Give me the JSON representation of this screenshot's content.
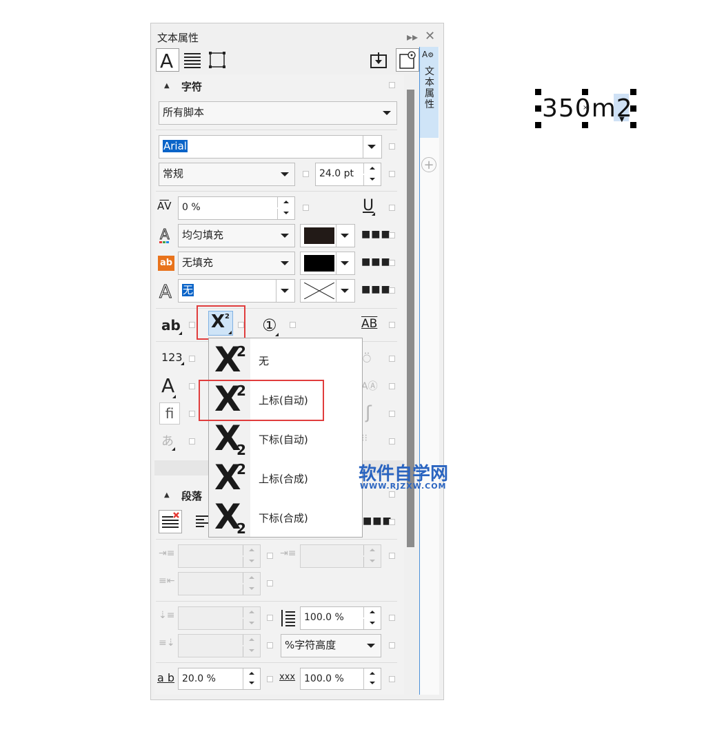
{
  "panel": {
    "title": "文本属性",
    "header_icons": [
      "expand-icon",
      "close-icon"
    ],
    "toolbar": {
      "tabs": [
        "character-tab",
        "paragraph-tab",
        "frame-tab"
      ],
      "right": [
        "import-icon",
        "preview-icon"
      ]
    }
  },
  "sidebar": {
    "tab_label": "文本属性"
  },
  "character": {
    "section_title": "字符",
    "script_select": "所有脚本",
    "font_name": "Arial",
    "font_style": "常规",
    "font_size": "24.0 pt",
    "kerning": "0 %",
    "fill_type": "均匀填充",
    "fill_color": "#221a17",
    "bg_fill_type": "无填充",
    "bg_fill_color": "#000000",
    "outline": "无"
  },
  "menu": {
    "items": [
      {
        "label": "无",
        "digit": "2",
        "position": "superscript"
      },
      {
        "label": "上标(自动)",
        "digit": "2",
        "position": "superscript"
      },
      {
        "label": "下标(自动)",
        "digit": "2",
        "position": "subscript"
      },
      {
        "label": "上标(合成)",
        "digit": "2",
        "position": "superscript"
      },
      {
        "label": "下标(合成)",
        "digit": "2",
        "position": "subscript"
      }
    ],
    "highlighted": "上标(自动)",
    "button_glyph": "X",
    "button_sup": "2"
  },
  "paragraph": {
    "section_title": "段落",
    "line_spacing": "100.0 %",
    "spacing_unit": "%字符高度",
    "char_spacing": "20.0 %",
    "word_spacing": "100.0 %"
  },
  "watermark": {
    "title": "软件自学网",
    "url": "WWW.RJZXW.COM"
  },
  "canvas": {
    "text": "350m2"
  }
}
